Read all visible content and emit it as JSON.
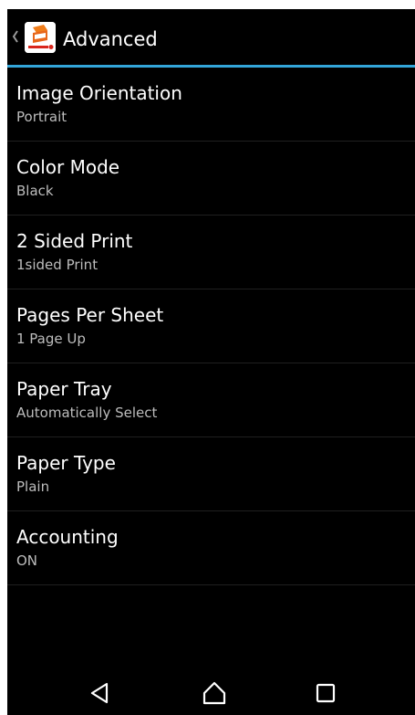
{
  "action_bar": {
    "title": "Advanced",
    "up_icon": "chevron-left-icon",
    "app_icon": "fujixerox-print-app-icon",
    "divider_color": "#33a5d9"
  },
  "settings": [
    {
      "title": "Image Orientation",
      "summary": "Portrait"
    },
    {
      "title": "Color Mode",
      "summary": "Black"
    },
    {
      "title": "2 Sided Print",
      "summary": "1sided Print"
    },
    {
      "title": "Pages Per Sheet",
      "summary": "1 Page Up"
    },
    {
      "title": "Paper Tray",
      "summary": "Automatically Select"
    },
    {
      "title": "Paper Type",
      "summary": "Plain"
    },
    {
      "title": "Accounting",
      "summary": "ON"
    }
  ],
  "nav_bar": {
    "back_icon": "back-triangle-icon",
    "home_icon": "home-icon",
    "recents_icon": "recents-square-icon"
  }
}
